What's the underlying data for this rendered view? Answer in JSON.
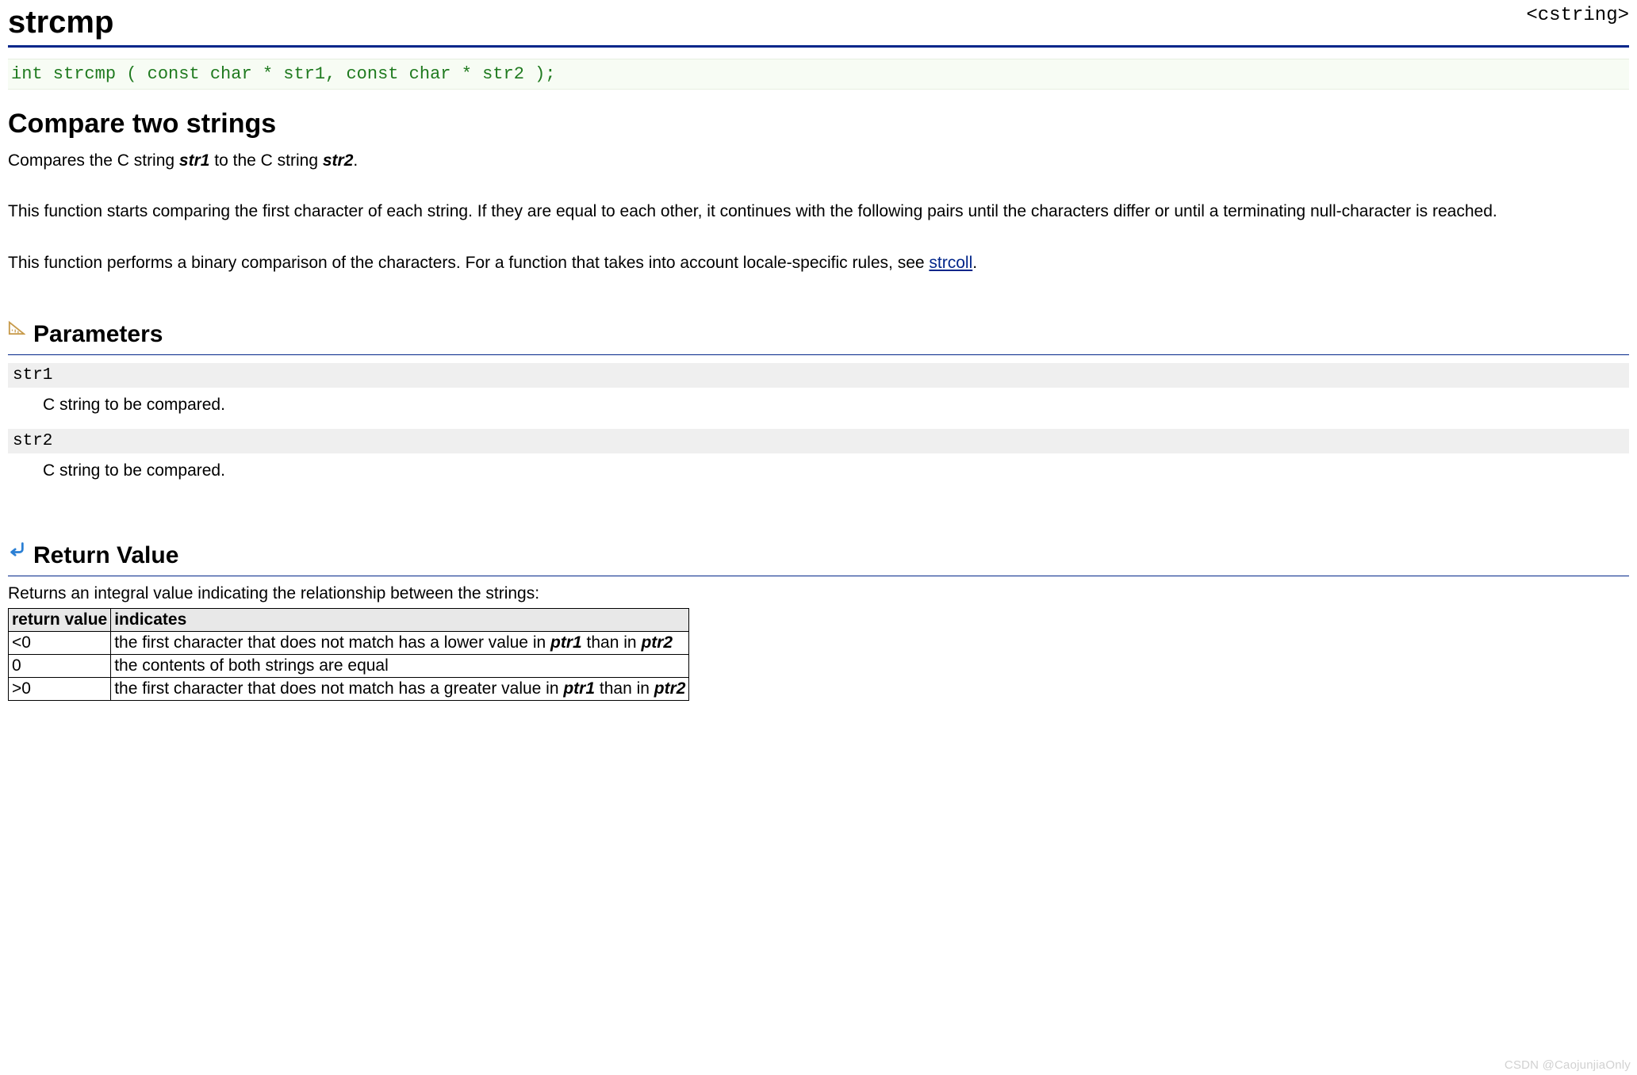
{
  "header": {
    "title": "strcmp",
    "include": "<cstring>"
  },
  "signature": "int strcmp ( const char * str1, const char * str2 );",
  "short_desc": "Compare two strings",
  "desc": {
    "p1_pre": "Compares the C string ",
    "p1_arg1": "str1",
    "p1_mid": " to the C string ",
    "p1_arg2": "str2",
    "p1_post": ".",
    "p2": "This function starts comparing the first character of each string. If they are equal to each other, it continues with the following pairs until the characters differ or until a terminating null-character is reached.",
    "p3_pre": "This function performs a binary comparison of the characters. For a function that takes into account locale-specific rules, see ",
    "p3_link": "strcoll",
    "p3_post": "."
  },
  "sections": {
    "parameters": "Parameters",
    "return_value": "Return Value"
  },
  "parameters": [
    {
      "name": "str1",
      "desc": "C string to be compared."
    },
    {
      "name": "str2",
      "desc": "C string to be compared."
    }
  ],
  "return": {
    "intro": "Returns an integral value indicating the relationship between the strings:",
    "headers": {
      "col1": "return value",
      "col2": "indicates"
    },
    "rows": [
      {
        "val": "<0",
        "pre": "the first character that does not match has a lower value in ",
        "a1": "ptr1",
        "mid": " than in ",
        "a2": "ptr2"
      },
      {
        "val": "0",
        "pre": "the contents of both strings are equal",
        "a1": "",
        "mid": "",
        "a2": ""
      },
      {
        "val": ">0",
        "pre": "the first character that does not match has a greater value in ",
        "a1": "ptr1",
        "mid": " than in ",
        "a2": "ptr2"
      }
    ]
  },
  "watermark": "CSDN @CaojunjiaOnly"
}
